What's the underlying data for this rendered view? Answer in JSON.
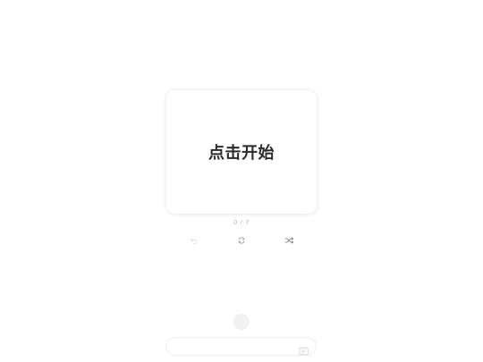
{
  "card": {
    "label": "点击开始"
  },
  "progress": {
    "text": "0 / 7",
    "current": 0,
    "total": 7
  },
  "controls": [
    {
      "name": "undo",
      "icon": "undo-icon"
    },
    {
      "name": "restart",
      "icon": "refresh-icon"
    },
    {
      "name": "shuffle",
      "icon": "shuffle-icon"
    }
  ],
  "input": {
    "value": "",
    "placeholder": "",
    "icon": "deck-icon"
  },
  "colors": {
    "card_text": "#2b2b2b",
    "muted": "#b7b7b7",
    "icon": "#9a9a9a",
    "faint_icon": "#dddddd"
  }
}
